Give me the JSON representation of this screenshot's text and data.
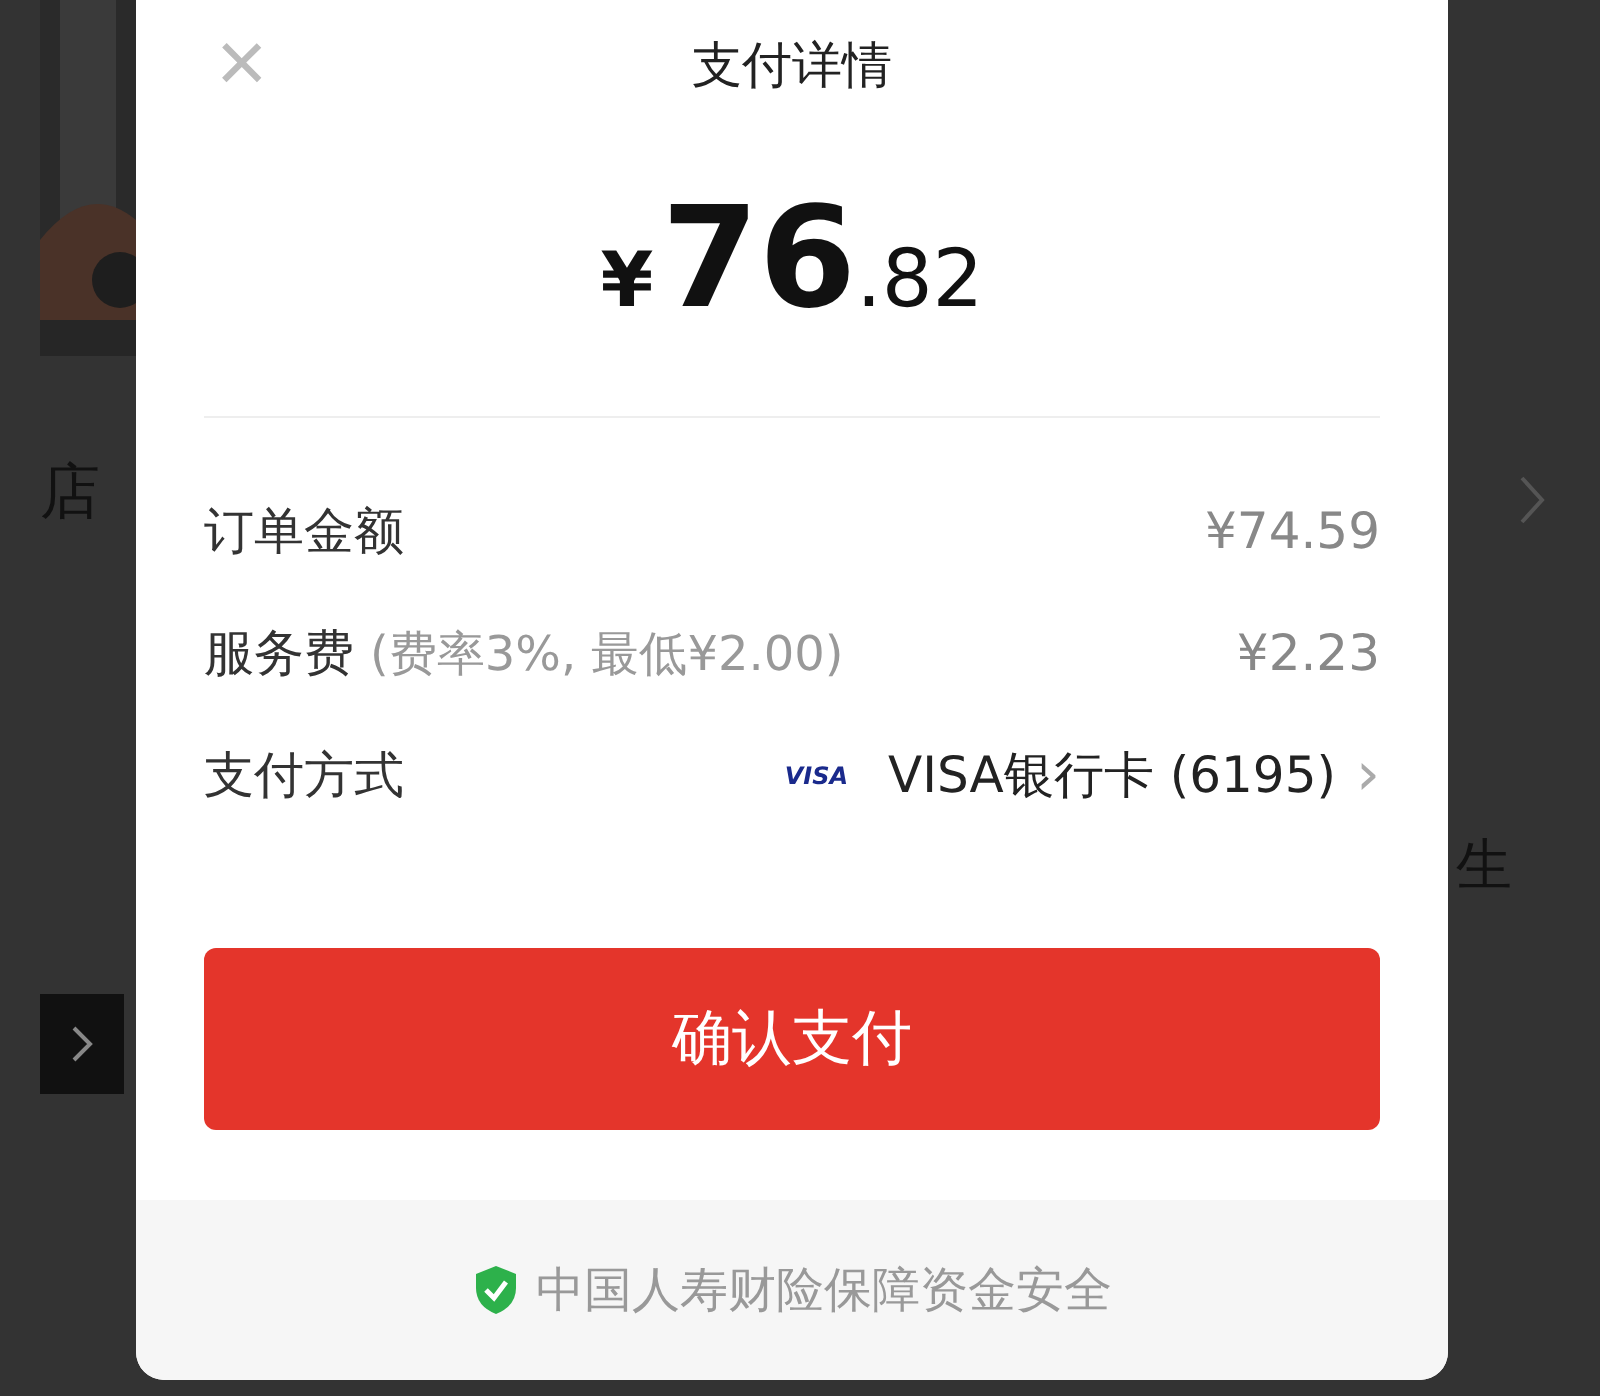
{
  "background": {
    "left_heading": "店",
    "right_text": "生"
  },
  "sheet": {
    "close": "×",
    "title": "支付详情",
    "amount": {
      "currency": "¥",
      "integer": "76",
      "decimal": ".82"
    },
    "rows": [
      {
        "kind": "plain",
        "label": "订单金额",
        "value": "¥74.59"
      },
      {
        "kind": "fee",
        "label": "服务费",
        "note": "(费率3%, 最低¥2.00)",
        "value": "¥2.23"
      },
      {
        "kind": "method",
        "label": "支付方式",
        "brand": "VISA",
        "value": "VISA银行卡 (6195)",
        "chevron": "›"
      }
    ],
    "confirm": "确认支付",
    "footer": "中国人寿财险保障资金安全"
  }
}
